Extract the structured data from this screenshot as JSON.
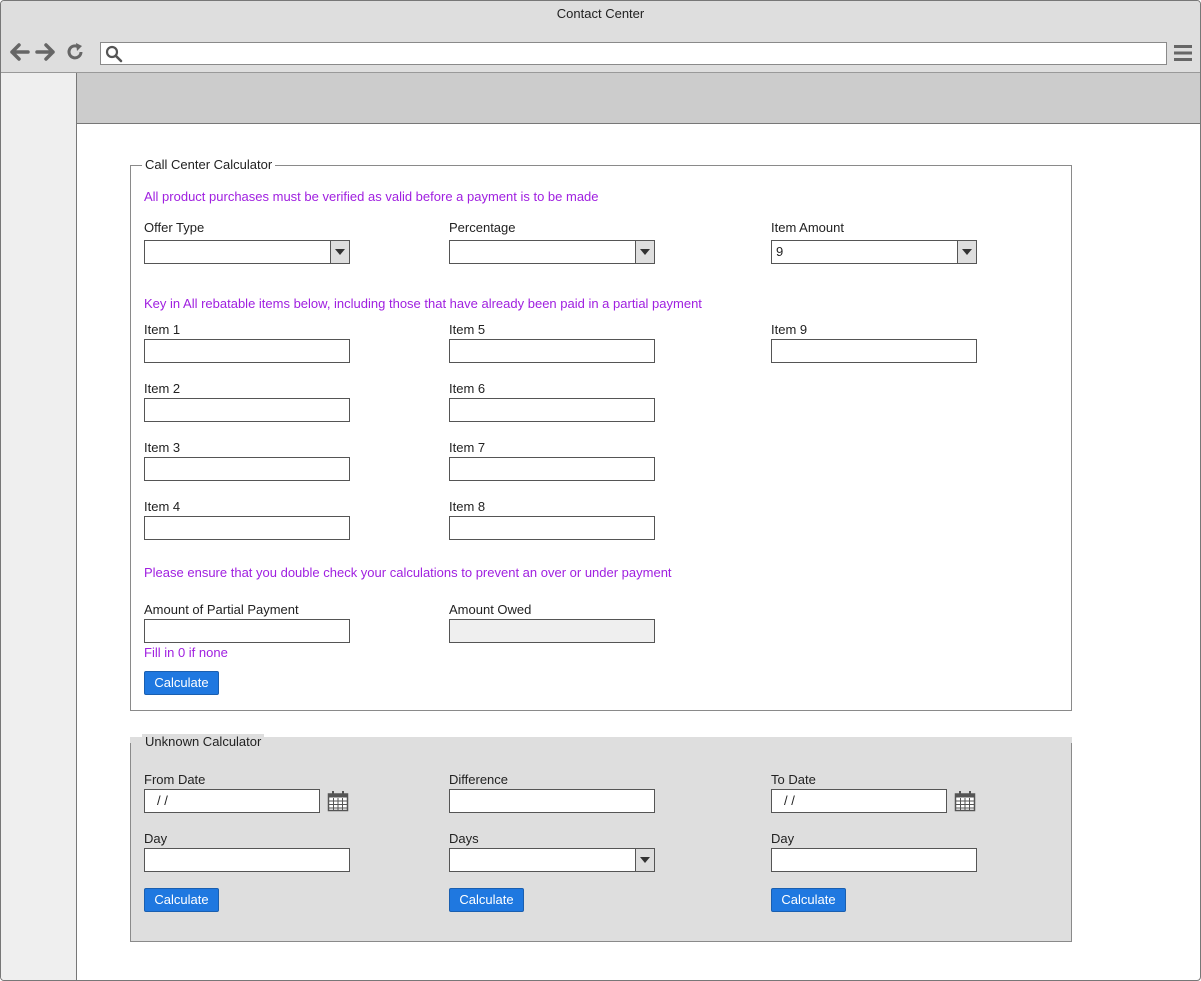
{
  "window": {
    "title": "Contact Center"
  },
  "browser": {
    "back_icon": "arrow-left-icon",
    "forward_icon": "arrow-right-icon",
    "reload_icon": "reload-icon",
    "search_icon": "search-icon",
    "menu_icon": "hamburger-menu-icon",
    "url_value": ""
  },
  "call_center": {
    "legend": "Call Center Calculator",
    "note_verify": "All product purchases must be verified as valid before a payment is to be made",
    "offer_type": {
      "label": "Offer Type",
      "value": ""
    },
    "percentage": {
      "label": "Percentage",
      "value": ""
    },
    "item_amount": {
      "label": "Item Amount",
      "value": "9"
    },
    "note_items": "Key in All rebatable items below, including those that have already been paid in a partial payment",
    "items": [
      {
        "label": "Item 1",
        "value": ""
      },
      {
        "label": "Item 2",
        "value": ""
      },
      {
        "label": "Item 3",
        "value": ""
      },
      {
        "label": "Item 4",
        "value": ""
      },
      {
        "label": "Item 5",
        "value": ""
      },
      {
        "label": "Item 6",
        "value": ""
      },
      {
        "label": "Item 7",
        "value": ""
      },
      {
        "label": "Item 8",
        "value": ""
      },
      {
        "label": "Item 9",
        "value": ""
      }
    ],
    "note_check": "Please ensure that you double check your calculations to prevent an over or under payment",
    "partial_payment": {
      "label": "Amount of Partial Payment",
      "value": "",
      "hint": "Fill in 0 if none"
    },
    "amount_owed": {
      "label": "Amount Owed",
      "value": ""
    },
    "calculate_label": "Calculate"
  },
  "unknown": {
    "legend": "Unknown Calculator",
    "from_date": {
      "label": "From Date",
      "value": "  /  /"
    },
    "difference": {
      "label": "Difference",
      "value": ""
    },
    "to_date": {
      "label": "To Date",
      "value": "  /  /"
    },
    "day_left": {
      "label": "Day",
      "value": ""
    },
    "days": {
      "label": "Days",
      "value": ""
    },
    "day_right": {
      "label": "Day",
      "value": ""
    },
    "calculate_label": "Calculate",
    "calendar_icon": "calendar-icon"
  },
  "colors": {
    "accent_button": "#1f78e0",
    "note_text": "#a020e0",
    "chrome": "#dedede"
  }
}
